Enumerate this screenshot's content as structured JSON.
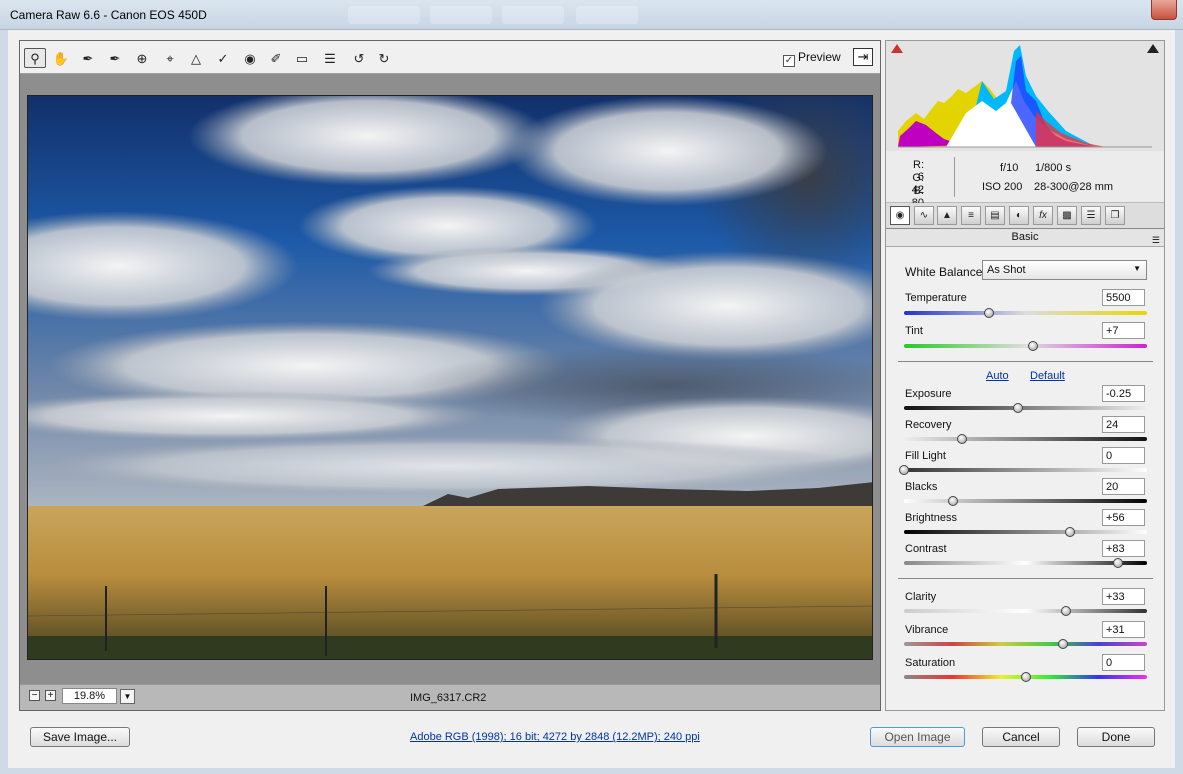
{
  "window": {
    "title": "Camera Raw 6.6  -  Canon EOS 450D"
  },
  "toolbar": {
    "tools": [
      "zoom-icon",
      "hand-icon",
      "white-balance-icon",
      "color-sampler-icon",
      "target-adjust-icon",
      "crop-icon",
      "straighten-icon",
      "spot-removal-icon",
      "red-eye-icon",
      "adjustment-brush-icon",
      "graduated-filter-icon",
      "preferences-icon",
      "rotate-ccw-icon",
      "rotate-cw-icon"
    ],
    "preview_label": "Preview",
    "preview_checked": true
  },
  "image": {
    "filename": "IMG_6317.CR2",
    "zoom": "19.8%"
  },
  "histogram": {
    "r": {
      "label": "R:",
      "value": "6"
    },
    "g": {
      "label": "G:",
      "value": "42"
    },
    "b": {
      "label": "B:",
      "value": "80"
    },
    "aperture": "f/10",
    "shutter": "1/800 s",
    "iso": "ISO 200",
    "lens": "28-300@28 mm"
  },
  "panel": {
    "section_title": "Basic",
    "white_balance_label": "White Balance:",
    "white_balance_value": "As Shot",
    "auto_label": "Auto",
    "default_label": "Default"
  },
  "sliders": {
    "temperature": {
      "label": "Temperature",
      "value": "5500",
      "position": 0.35
    },
    "tint": {
      "label": "Tint",
      "value": "+7",
      "position": 0.53
    },
    "exposure": {
      "label": "Exposure",
      "value": "-0.25",
      "position": 0.47
    },
    "recovery": {
      "label": "Recovery",
      "value": "24",
      "position": 0.24
    },
    "fill_light": {
      "label": "Fill Light",
      "value": "0",
      "position": 0.0
    },
    "blacks": {
      "label": "Blacks",
      "value": "20",
      "position": 0.2
    },
    "brightness": {
      "label": "Brightness",
      "value": "+56",
      "position": 0.685
    },
    "contrast": {
      "label": "Contrast",
      "value": "+83",
      "position": 0.88
    },
    "clarity": {
      "label": "Clarity",
      "value": "+33",
      "position": 0.665
    },
    "vibrance": {
      "label": "Vibrance",
      "value": "+31",
      "position": 0.655
    },
    "saturation": {
      "label": "Saturation",
      "value": "0",
      "position": 0.5
    }
  },
  "footer": {
    "save_label": "Save Image...",
    "workflow_info": "Adobe RGB (1998); 16 bit; 4272 by 2848 (12.2MP); 240 ppi",
    "open_label": "Open Image",
    "cancel_label": "Cancel",
    "done_label": "Done"
  },
  "colors": {
    "accent": "#4e9ad6",
    "link": "#0033aa"
  }
}
